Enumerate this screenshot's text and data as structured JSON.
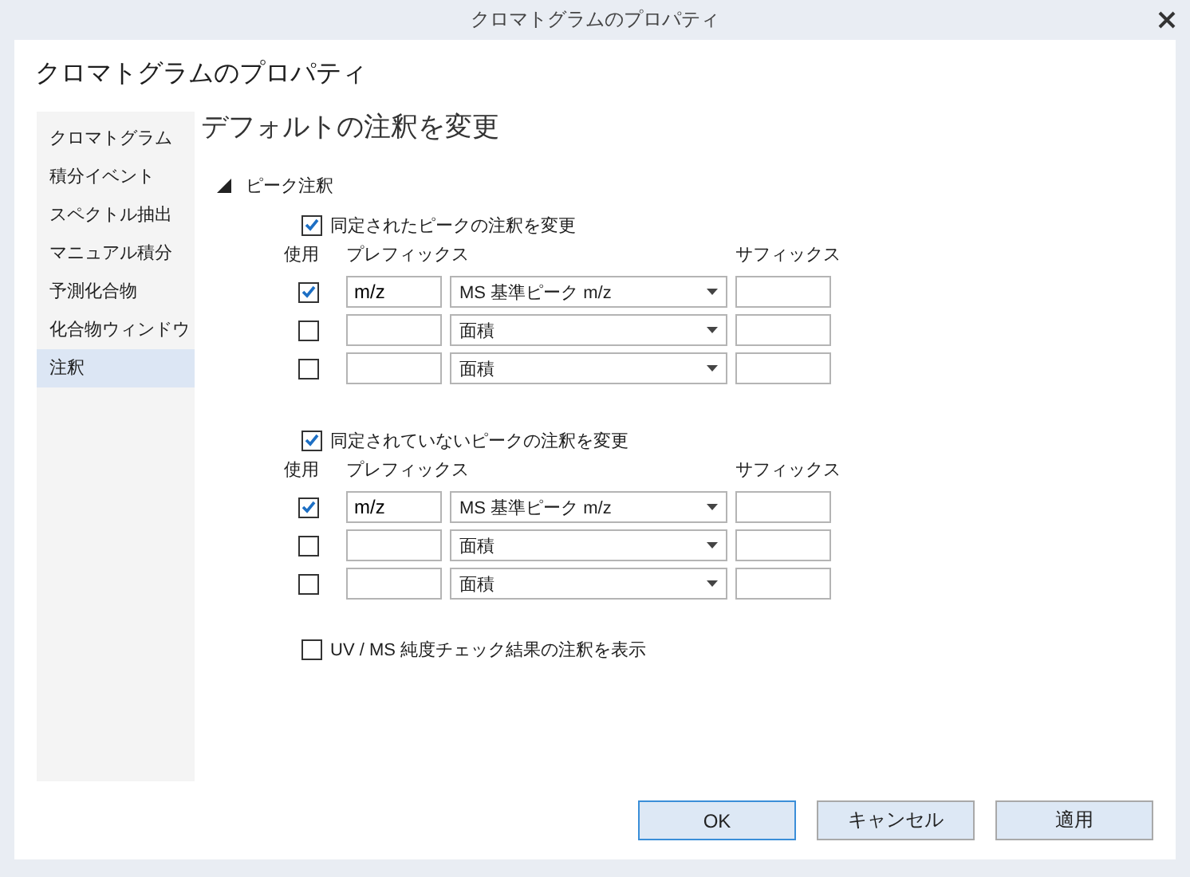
{
  "window": {
    "title": "クロマトグラムのプロパティ"
  },
  "dialog_title": "クロマトグラムのプロパティ",
  "sidebar": {
    "items": [
      {
        "label": "クロマトグラム",
        "selected": false
      },
      {
        "label": "積分イベント",
        "selected": false
      },
      {
        "label": "スペクトル抽出",
        "selected": false
      },
      {
        "label": "マニュアル積分",
        "selected": false
      },
      {
        "label": "予測化合物",
        "selected": false
      },
      {
        "label": "化合物ウィンドウ",
        "selected": false
      },
      {
        "label": "注釈",
        "selected": true
      }
    ]
  },
  "page_title": "デフォルトの注釈を変更",
  "section": {
    "label": "ピーク注釈",
    "expanded": true,
    "groups": [
      {
        "label": "同定されたピークの注釈を変更",
        "checked": true,
        "columns": {
          "use": "使用",
          "prefix": "プレフィックス",
          "suffix": "サフィックス"
        },
        "rows": [
          {
            "use": true,
            "prefix": "m/z",
            "type": "MS 基準ピーク m/z"
          },
          {
            "use": false,
            "type": "面積"
          },
          {
            "use": false,
            "type": "面積"
          }
        ]
      },
      {
        "label": "同定されていないピークの注釈を変更",
        "checked": true,
        "columns": {
          "use": "使用",
          "prefix": "プレフィックス",
          "suffix": "サフィックス"
        },
        "rows": [
          {
            "use": true,
            "prefix": "m/z",
            "type": "MS 基準ピーク m/z"
          },
          {
            "use": false,
            "type": "面積"
          },
          {
            "use": false,
            "type": "面積"
          }
        ]
      }
    ],
    "purity_check": {
      "label": "UV / MS 純度チェック結果の注釈を表示",
      "checked": false
    }
  },
  "buttons": [
    {
      "label": "OK",
      "default": true
    },
    {
      "label": "キャンセル",
      "default": false
    },
    {
      "label": "適用",
      "default": false
    }
  ]
}
